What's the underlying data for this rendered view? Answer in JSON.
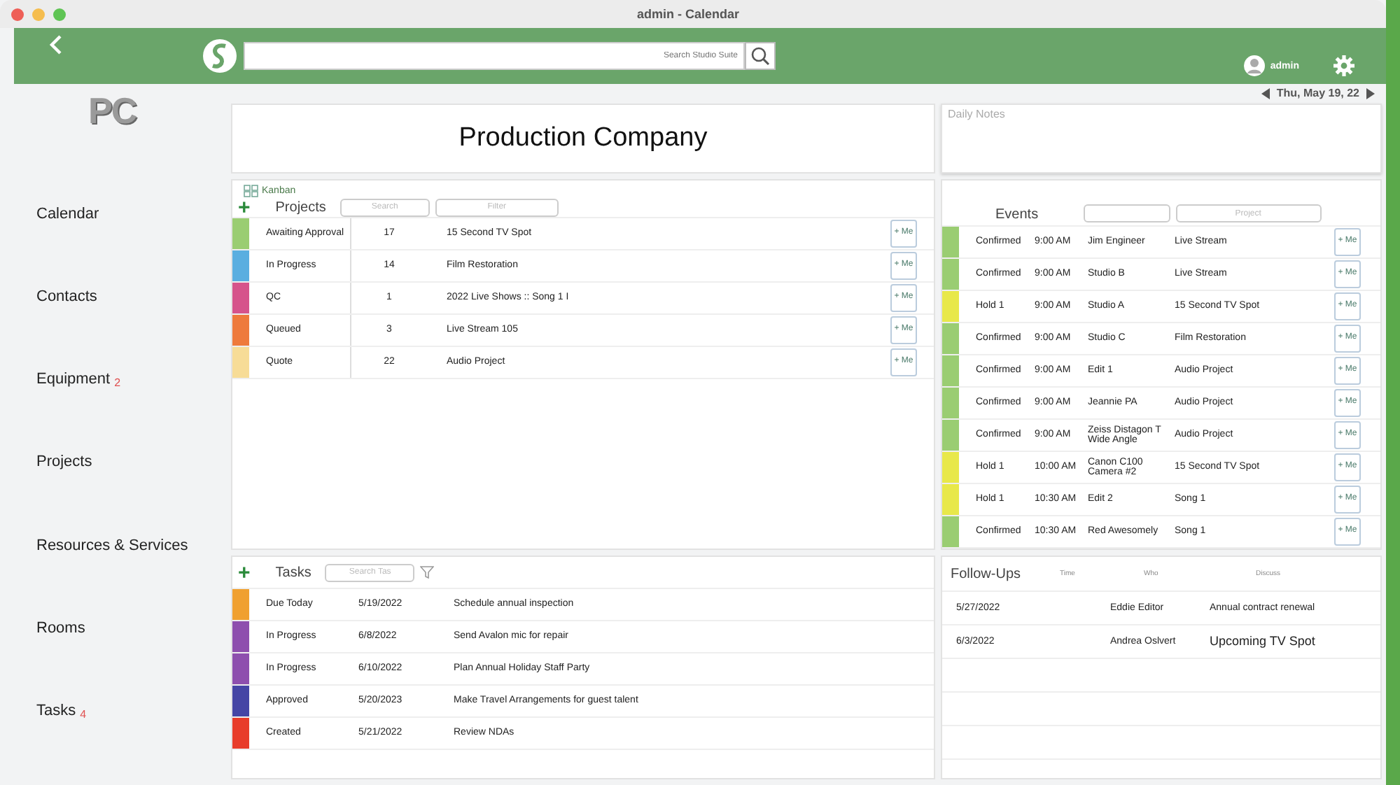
{
  "window": {
    "title": "admin - Calendar"
  },
  "header": {
    "search": {
      "placeholder": "Search Studio Suite"
    },
    "user": "admin"
  },
  "date": "Thu, May 19, 22",
  "logo": "PC",
  "sidebar": {
    "items": [
      {
        "label": "Calendar"
      },
      {
        "label": "Contacts"
      },
      {
        "label": "Equipment",
        "badge": "2"
      },
      {
        "label": "Projects"
      },
      {
        "label": "Resources & Services"
      },
      {
        "label": "Rooms"
      },
      {
        "label": "Tasks",
        "badge": "4"
      }
    ]
  },
  "company": "Production Company",
  "daily_notes": {
    "placeholder": "Daily Notes"
  },
  "projects": {
    "view": "Kanban",
    "add_button": "+",
    "title": "Projects",
    "search": {
      "placeholder": "Search"
    },
    "filter": {
      "placeholder": "Filter"
    },
    "rows": [
      {
        "status": "Awaiting Approval",
        "color": "#9acd72",
        "count": "17",
        "name": "15 Second TV Spot",
        "button": "+ Me"
      },
      {
        "status": "In Progress",
        "color": "#5aaee0",
        "count": "14",
        "name": "Film Restoration",
        "button": "+ Me"
      },
      {
        "status": "QC",
        "color": "#d6538b",
        "count": "1",
        "name": "2022 Live Shows :: Song 1 I",
        "button": "+ Me"
      },
      {
        "status": "Queued",
        "color": "#ee7a3c",
        "count": "3",
        "name": "Live Stream 105",
        "button": "+ Me"
      },
      {
        "status": "Quote",
        "color": "#f7dc97",
        "count": "22",
        "name": "Audio Project",
        "button": "+ Me"
      }
    ]
  },
  "events": {
    "title": "Events",
    "project": {
      "placeholder": "Project"
    },
    "rows": [
      {
        "status": "Confirmed",
        "color": "#9acd72",
        "time": "9:00 AM",
        "resource": "Jim Engineer",
        "project": "Live Stream",
        "button": "+ Me"
      },
      {
        "status": "Confirmed",
        "color": "#9acd72",
        "time": "9:00 AM",
        "resource": "Studio B",
        "project": "Live Stream",
        "button": "+ Me"
      },
      {
        "status": "Hold 1",
        "color": "#e8e84a",
        "time": "9:00 AM",
        "resource": "Studio A",
        "project": "15 Second TV Spot",
        "button": "+ Me"
      },
      {
        "status": "Confirmed",
        "color": "#9acd72",
        "time": "9:00 AM",
        "resource": "Studio C",
        "project": "Film Restoration",
        "button": "+ Me"
      },
      {
        "status": "Confirmed",
        "color": "#9acd72",
        "time": "9:00 AM",
        "resource": "Edit 1",
        "project": "Audio Project",
        "button": "+ Me"
      },
      {
        "status": "Confirmed",
        "color": "#9acd72",
        "time": "9:00 AM",
        "resource": "Jeannie PA",
        "project": "Audio Project",
        "button": "+ Me"
      },
      {
        "status": "Confirmed",
        "color": "#9acd72",
        "time": "9:00 AM",
        "resource": "Zeiss Distagon T Wide Angle",
        "project": "Audio Project",
        "button": "+ Me"
      },
      {
        "status": "Hold 1",
        "color": "#e8e84a",
        "time": "10:00 AM",
        "resource": "Canon C100 Camera #2",
        "project": "15 Second TV Spot",
        "button": "+ Me"
      },
      {
        "status": "Hold 1",
        "color": "#e8e84a",
        "time": "10:30 AM",
        "resource": "Edit 2",
        "project": "Song 1",
        "button": "+ Me"
      },
      {
        "status": "Confirmed",
        "color": "#9acd72",
        "time": "10:30 AM",
        "resource": "Red Awesomely",
        "project": "Song 1",
        "button": "+ Me"
      }
    ]
  },
  "tasks": {
    "add_button": "+",
    "title": "Tasks",
    "search": {
      "placeholder": "Search Tas"
    },
    "rows": [
      {
        "status": "Due Today",
        "color": "#f0a030",
        "date": "5/19/2022",
        "name": "Schedule annual inspection"
      },
      {
        "status": "In Progress",
        "color": "#8e4fae",
        "date": "6/8/2022",
        "name": "Send Avalon mic for repair"
      },
      {
        "status": "In Progress",
        "color": "#8e4fae",
        "date": "6/10/2022",
        "name": "Plan Annual Holiday Staff Party"
      },
      {
        "status": "Approved",
        "color": "#4545a5",
        "date": "5/20/2023",
        "name": "Make Travel Arrangements for guest talent"
      },
      {
        "status": "Created",
        "color": "#e83c2a",
        "date": "5/21/2022",
        "name": "Review NDAs"
      }
    ]
  },
  "follow_ups": {
    "title": "Follow-Ups",
    "columns": [
      "Time",
      "Who",
      "Discuss"
    ],
    "rows": [
      {
        "date": "5/27/2022",
        "who": "Eddie Editor",
        "discuss": "Annual contract renewal"
      },
      {
        "date": "6/3/2022",
        "who": "Andrea Oslvert",
        "discuss": "Upcoming TV Spot"
      }
    ]
  }
}
